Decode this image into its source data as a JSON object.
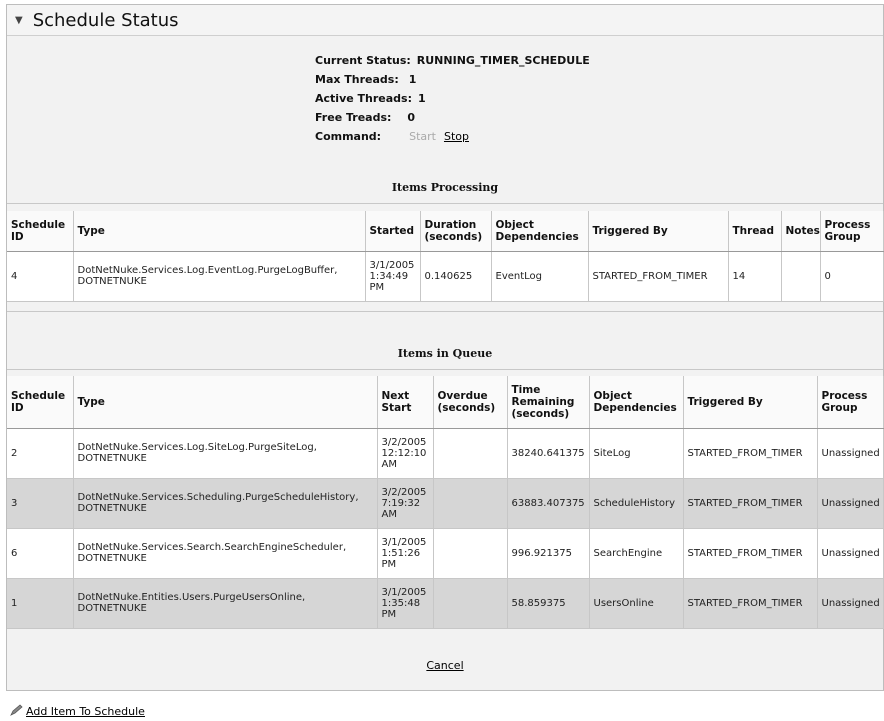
{
  "title": "Schedule Status",
  "status": {
    "current_status_label": "Current Status:",
    "current_status_value": "RUNNING_TIMER_SCHEDULE",
    "max_threads_label": "Max Threads:",
    "max_threads_value": "1",
    "active_threads_label": "Active Threads:",
    "active_threads_value": "1",
    "free_threads_label": "Free Treads:",
    "free_threads_value": "0",
    "command_label": "Command:",
    "start_label": "Start",
    "stop_label": "Stop"
  },
  "processing": {
    "title": "Items Processing",
    "headers": [
      "Schedule ID",
      "Type",
      "Started",
      "Duration (seconds)",
      "Object Dependencies",
      "Triggered By",
      "Thread",
      "Notes",
      "Process Group"
    ],
    "rows": [
      [
        "4",
        "DotNetNuke.Services.Log.EventLog.PurgeLogBuffer, DOTNETNUKE",
        "3/1/2005 1:34:49 PM",
        "0.140625",
        "EventLog",
        "STARTED_FROM_TIMER",
        "14",
        "",
        "0"
      ]
    ]
  },
  "queue": {
    "title": "Items in Queue",
    "headers": [
      "Schedule ID",
      "Type",
      "Next Start",
      "Overdue (seconds)",
      "Time Remaining (seconds)",
      "Object Dependencies",
      "Triggered By",
      "Process Group"
    ],
    "rows": [
      [
        "2",
        "DotNetNuke.Services.Log.SiteLog.PurgeSiteLog, DOTNETNUKE",
        "3/2/2005 12:12:10 AM",
        "",
        "38240.641375",
        "SiteLog",
        "STARTED_FROM_TIMER",
        "Unassigned"
      ],
      [
        "3",
        "DotNetNuke.Services.Scheduling.PurgeScheduleHistory, DOTNETNUKE",
        "3/2/2005 7:19:32 AM",
        "",
        "63883.407375",
        "ScheduleHistory",
        "STARTED_FROM_TIMER",
        "Unassigned"
      ],
      [
        "6",
        "DotNetNuke.Services.Search.SearchEngineScheduler, DOTNETNUKE",
        "3/1/2005 1:51:26 PM",
        "",
        "996.921375",
        "SearchEngine",
        "STARTED_FROM_TIMER",
        "Unassigned"
      ],
      [
        "1",
        "DotNetNuke.Entities.Users.PurgeUsersOnline, DOTNETNUKE",
        "3/1/2005 1:35:48 PM",
        "",
        "58.859375",
        "UsersOnline",
        "STARTED_FROM_TIMER",
        "Unassigned"
      ]
    ]
  },
  "cancel_label": "Cancel",
  "add_item_label": "Add Item To Schedule",
  "icons": {
    "collapse": "collapse-arrow-icon",
    "add": "pencil-icon"
  }
}
